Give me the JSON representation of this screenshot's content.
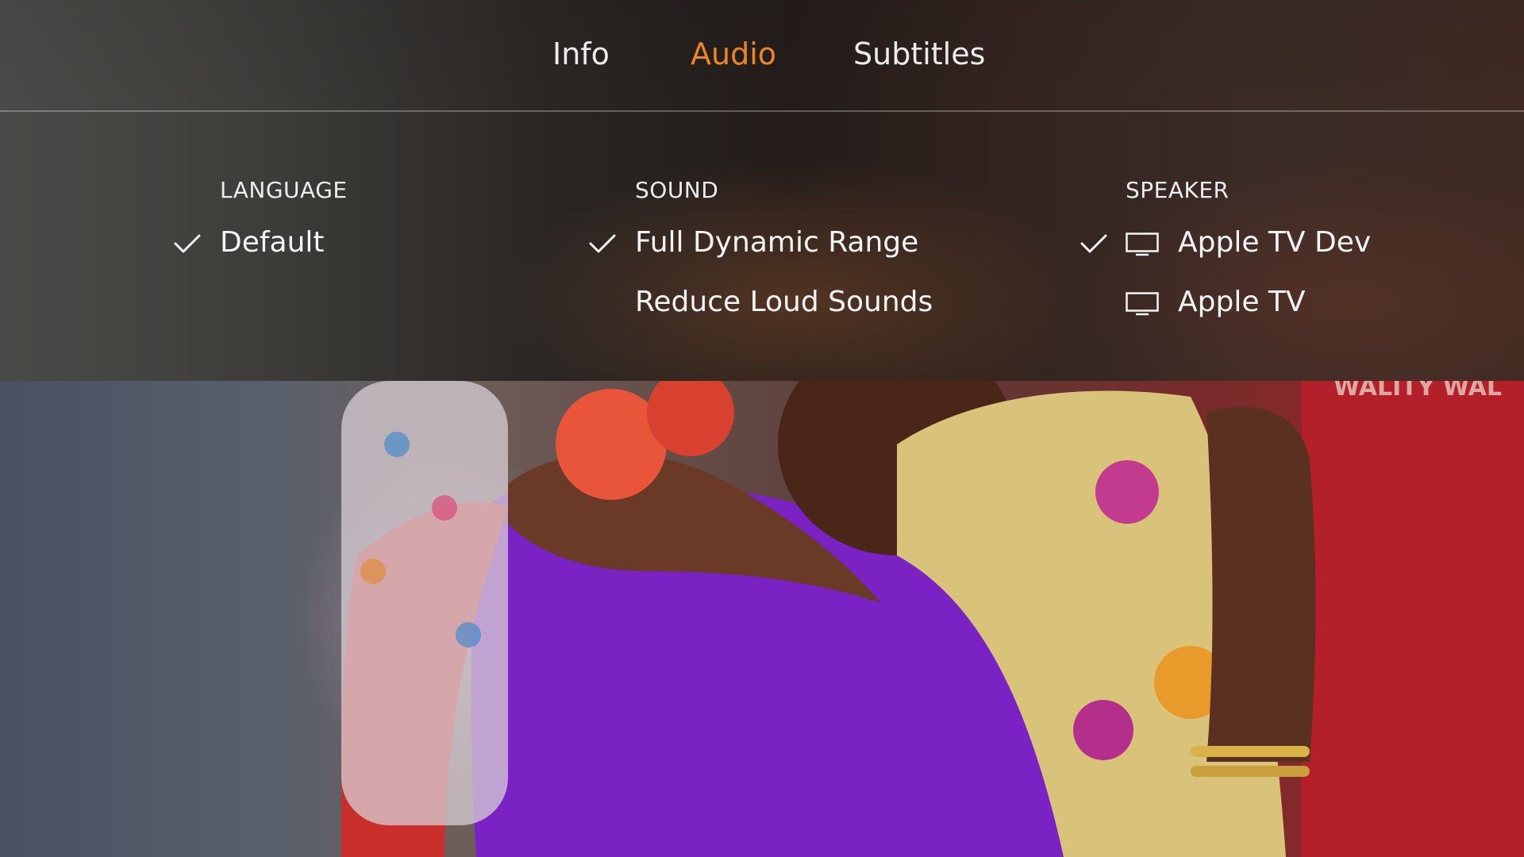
{
  "tabs": [
    {
      "label": "Info",
      "active": false
    },
    {
      "label": "Audio",
      "active": true
    },
    {
      "label": "Subtitles",
      "active": false
    }
  ],
  "accent_color": "#f08a24",
  "sections": {
    "language": {
      "title": "LANGUAGE",
      "options": [
        {
          "label": "Default",
          "selected": true
        }
      ]
    },
    "sound": {
      "title": "SOUND",
      "options": [
        {
          "label": "Full Dynamic Range",
          "selected": true
        },
        {
          "label": "Reduce Loud Sounds",
          "selected": false
        }
      ]
    },
    "speaker": {
      "title": "SPEAKER",
      "options": [
        {
          "label": "Apple TV Dev",
          "selected": true,
          "icon": "tv-icon"
        },
        {
          "label": "Apple TV",
          "selected": false,
          "icon": "tv-icon"
        }
      ]
    }
  },
  "background_text": "WALITY WAL"
}
